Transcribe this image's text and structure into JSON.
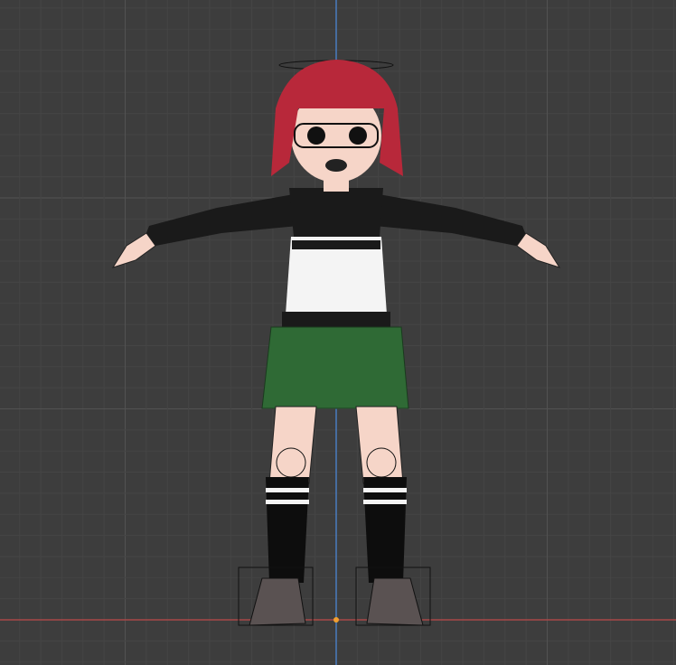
{
  "viewport": {
    "background": "#3d3d3d",
    "grid_minor": "#454545",
    "grid_major": "#525252",
    "x_axis_color": "#b04a4a",
    "z_axis_color": "#4a7cc0",
    "origin_color": "#f0a030"
  },
  "character": {
    "hair": "#b8283a",
    "skin": "#f6d5c8",
    "jacket": "#1a1a1a",
    "shirt": "#f4f4f4",
    "skirt": "#2f6a35",
    "socks": "#0d0d0d",
    "shoes": "#5a5252"
  }
}
